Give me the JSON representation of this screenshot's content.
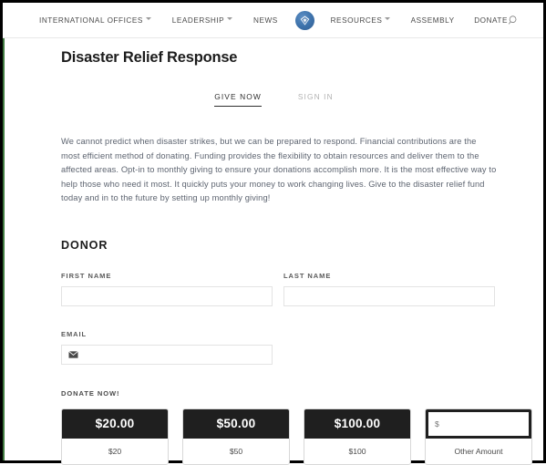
{
  "nav": {
    "items": [
      {
        "label": "INTERNATIONAL OFFICES",
        "has_caret": true
      },
      {
        "label": "LEADERSHIP",
        "has_caret": true
      },
      {
        "label": "NEWS",
        "has_caret": false
      },
      {
        "label": "RESOURCES",
        "has_caret": true
      },
      {
        "label": "ASSEMBLY",
        "has_caret": false
      },
      {
        "label": "DONATE",
        "has_caret": false
      }
    ],
    "logo_icon": "diamond-shield-logo-icon",
    "search_icon": "search-icon",
    "logo_color": "#3f74ad"
  },
  "header": {
    "title": "Disaster Relief Response"
  },
  "tabs": [
    {
      "label": "GIVE NOW",
      "active": true
    },
    {
      "label": "SIGN IN",
      "active": false
    }
  ],
  "intro": {
    "paragraph": "We cannot predict when disaster strikes, but we can be prepared to respond. Financial contributions are the most efficient method of donating. Funding provides the flexibility to obtain resources and deliver them to the affected areas. Opt-in to monthly giving to ensure your donations accomplish more. It is the most effective way to help those who need it most. It quickly puts your money to work changing lives. Give to the disaster relief fund today and in to the future by setting up monthly giving!"
  },
  "donor": {
    "section_heading": "DONOR",
    "first_name": {
      "label": "FIRST NAME",
      "value": "",
      "placeholder": ""
    },
    "last_name": {
      "label": "LAST NAME",
      "value": "",
      "placeholder": ""
    },
    "email": {
      "label": "EMAIL",
      "value": "",
      "placeholder": "",
      "icon": "envelope-icon"
    }
  },
  "donate": {
    "label": "DONATE NOW!",
    "amounts": [
      {
        "display": "$20.00",
        "caption": "$20"
      },
      {
        "display": "$50.00",
        "caption": "$50"
      },
      {
        "display": "$100.00",
        "caption": "$100"
      }
    ],
    "custom": {
      "value": "",
      "placeholder": "$",
      "caption": "Other Amount"
    },
    "accent_dark": "#1f1f1f"
  },
  "theme": {
    "frame_color": "#000000",
    "accent_green": "#3f7a3f"
  }
}
